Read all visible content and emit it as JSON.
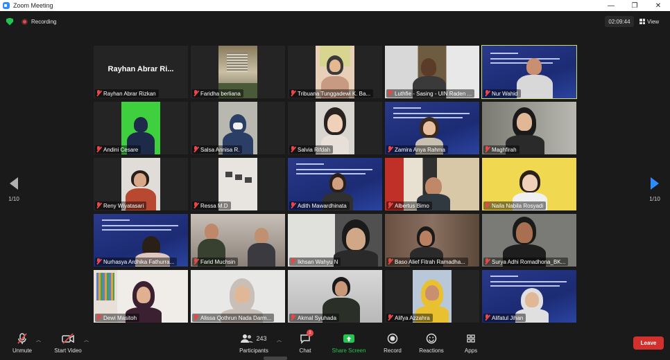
{
  "window": {
    "title": "Zoom Meeting",
    "controls": [
      "—",
      "❐",
      "✕"
    ]
  },
  "top": {
    "recording_label": "Recording",
    "timer": "02:09:44",
    "view_label": "View"
  },
  "pager": {
    "left_page": "1/10",
    "right_page": "1/10"
  },
  "participants": [
    {
      "name": "Rayhan Abrar Rizkan",
      "display": "Rayhan Abrar Ri..."
    },
    {
      "name": "Faridha berliana"
    },
    {
      "name": "Tribuana Tunggadewi K. Ba..."
    },
    {
      "name": "Luthfie - Sasing - UIN Raden ..."
    },
    {
      "name": "Nur Wahid"
    },
    {
      "name": "Andini Cesare"
    },
    {
      "name": "Salsa Annisa R."
    },
    {
      "name": "Salvia Rifdah"
    },
    {
      "name": "Zamira Anya Rahma"
    },
    {
      "name": "Maghfirah"
    },
    {
      "name": "Reny Wiyatasari"
    },
    {
      "name": "Ressa M.D"
    },
    {
      "name": "Adith Mawardhinata"
    },
    {
      "name": "Albertus Bimo"
    },
    {
      "name": "Naila Nabila Rosyadi"
    },
    {
      "name": "Nurhasya Ardhika Fathurra..."
    },
    {
      "name": "Farid Muchsin"
    },
    {
      "name": "Ikhsan Wahyu N"
    },
    {
      "name": "Baso Alief Fitrah Ramadha..."
    },
    {
      "name": "Surya Adhi Romadhona_BK..."
    },
    {
      "name": "Dewi Masitoh"
    },
    {
      "name": "Alissa Qothrun Nada Darm..."
    },
    {
      "name": "Akmal Syuhada"
    },
    {
      "name": "Alifya Azzahra"
    },
    {
      "name": "Alifatul Jihan"
    }
  ],
  "toolbar": {
    "unmute": "Unmute",
    "start_video": "Start Video",
    "participants_count": "243",
    "participants": "Participants",
    "chat": "Chat",
    "chat_badge": "1",
    "share_screen": "Share Screen",
    "record": "Record",
    "reactions": "Reactions",
    "apps": "Apps",
    "leave": "Leave"
  },
  "colors": {
    "accent": "#2d8cff",
    "share": "#23c552",
    "leave": "#d0312d",
    "active_speaker": "#c9e06a"
  }
}
